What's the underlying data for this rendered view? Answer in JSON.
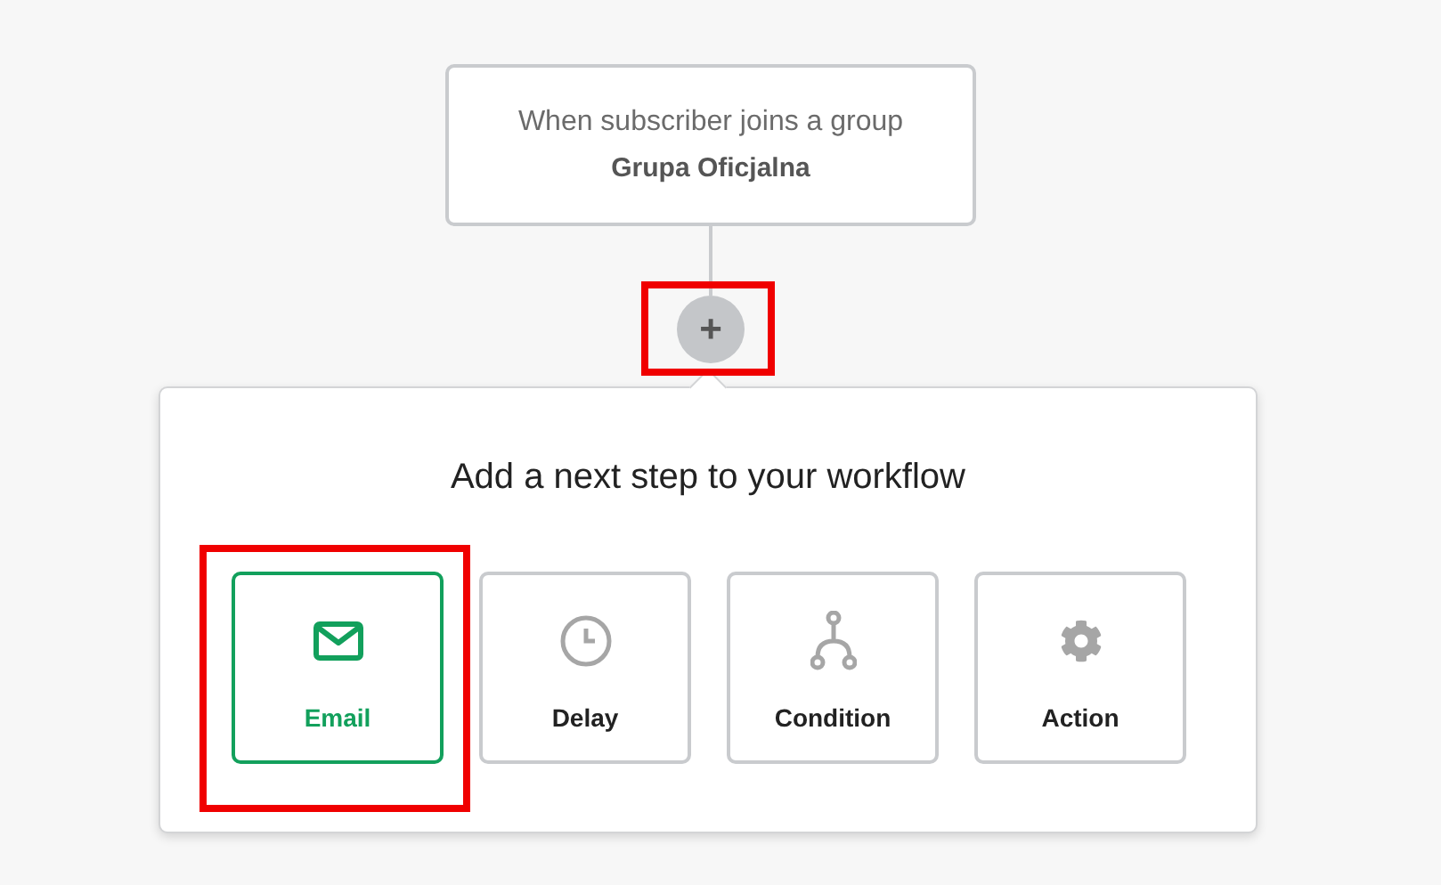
{
  "trigger": {
    "label": "When subscriber joins a group",
    "group": "Grupa Oficjalna"
  },
  "add_button": {
    "label": "+",
    "highlighted": true
  },
  "popover": {
    "title": "Add a next step to your workflow",
    "options": [
      {
        "kind": "email",
        "label": "Email",
        "selected": true,
        "highlighted": true
      },
      {
        "kind": "delay",
        "label": "Delay",
        "selected": false,
        "highlighted": false
      },
      {
        "kind": "condition",
        "label": "Condition",
        "selected": false,
        "highlighted": false
      },
      {
        "kind": "action",
        "label": "Action",
        "selected": false,
        "highlighted": false
      }
    ]
  }
}
